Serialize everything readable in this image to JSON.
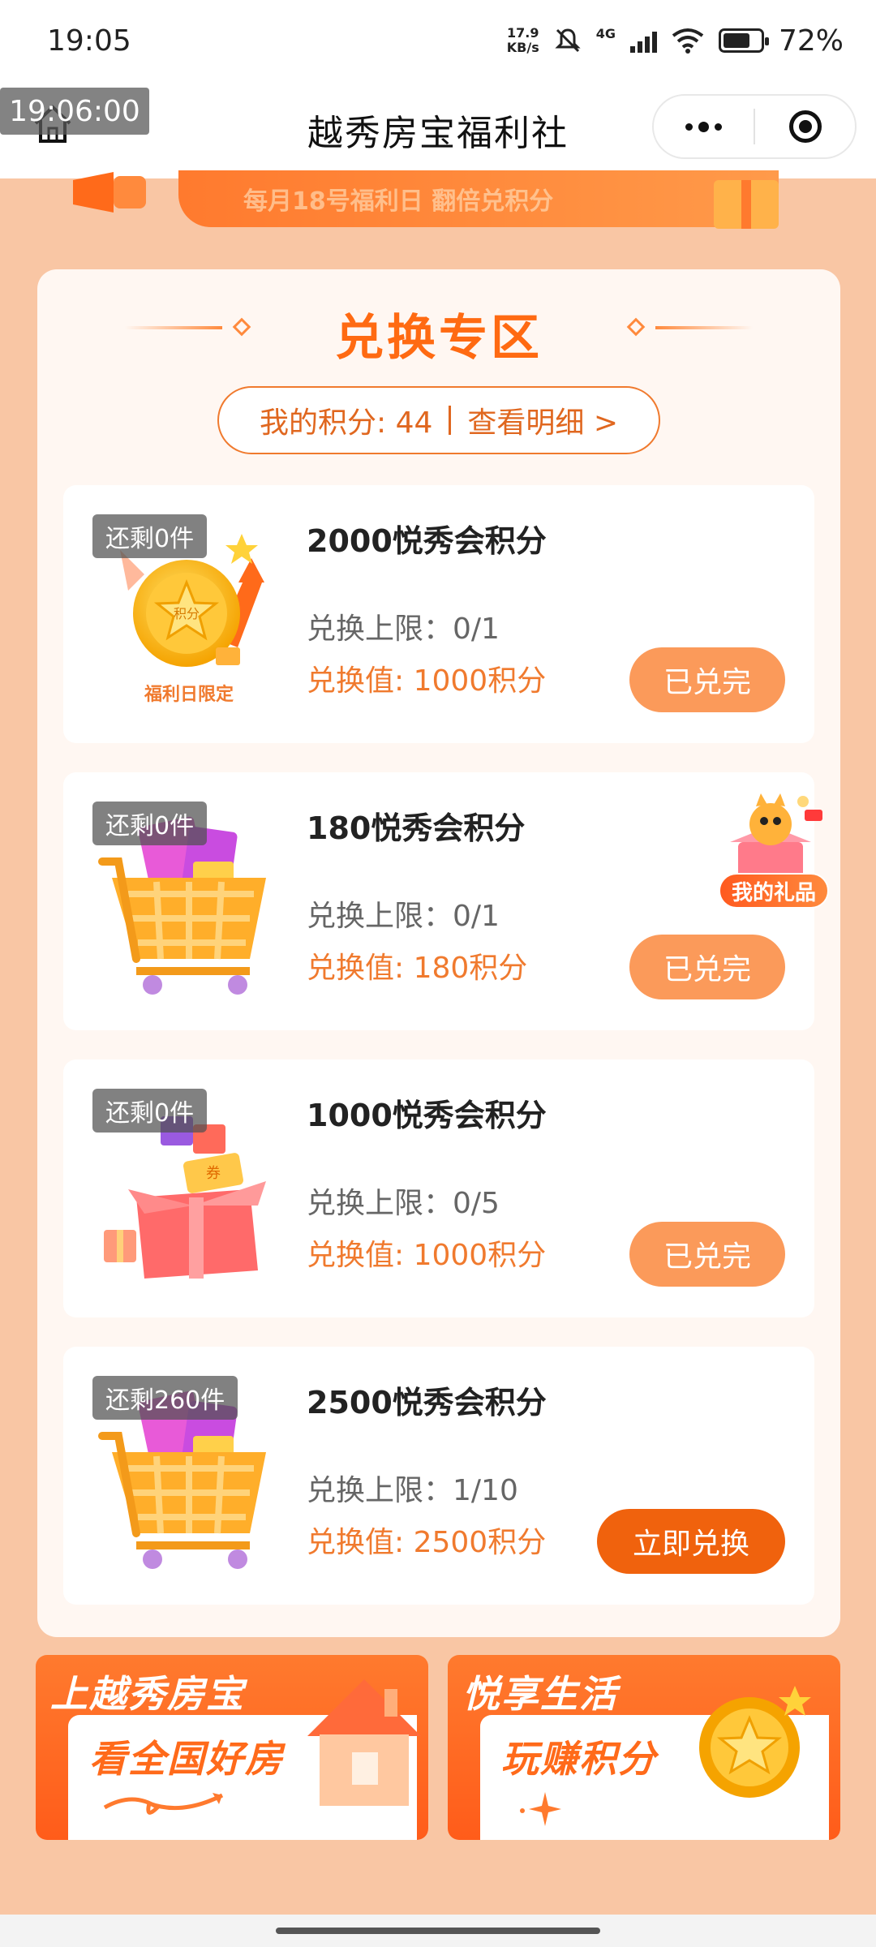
{
  "status_bar": {
    "time": "19:05",
    "net_speed_value": "17.9",
    "net_speed_unit": "KB/s",
    "network": "4G",
    "battery": "72%",
    "battery_level": 0.72
  },
  "title_bar": {
    "title": "越秀房宝福利社",
    "time_badge": "19:06:00"
  },
  "top_banner": {
    "text": "每月18号福利日 翻倍兑积分"
  },
  "exchange": {
    "title": "兑换专区",
    "points_label": "我的积分: 44",
    "details_link": "查看明细 >"
  },
  "items": [
    {
      "stock": "还剩0件",
      "name": "2000悦秀会积分",
      "limit": "兑换上限：0/1",
      "cost": "兑换值: 1000积分",
      "button": "已兑完",
      "image_caption": "福利日限定",
      "coin_text": "积分"
    },
    {
      "stock": "还剩0件",
      "name": "180悦秀会积分",
      "limit": "兑换上限：0/1",
      "cost": "兑换值: 180积分",
      "button": "已兑完"
    },
    {
      "stock": "还剩0件",
      "name": "1000悦秀会积分",
      "limit": "兑换上限：0/5",
      "cost": "兑换值: 1000积分",
      "button": "已兑完",
      "coupon_text": "券"
    },
    {
      "stock": "还剩260件",
      "name": "2500悦秀会积分",
      "limit": "兑换上限：1/10",
      "cost": "兑换值: 2500积分",
      "button": "立即兑换"
    }
  ],
  "floating": {
    "label": "我的礼品"
  },
  "banners": [
    {
      "head": "上越秀房宝",
      "sub": "看全国好房"
    },
    {
      "head": "悦享生活",
      "sub": "玩赚积分"
    }
  ],
  "colors": {
    "accent": "#f0620d",
    "page_bg": "#f9c6a4",
    "disabled_button": "#fb9a5a"
  }
}
